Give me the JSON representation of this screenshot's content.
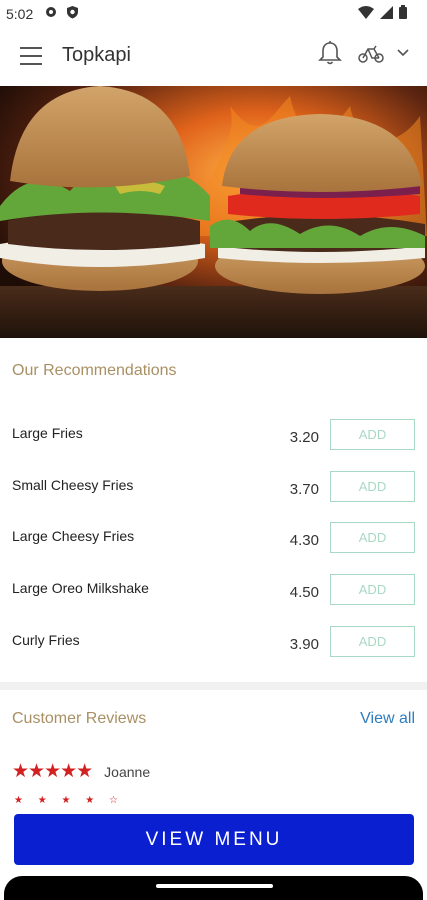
{
  "status": {
    "time": "5:02"
  },
  "app": {
    "title": "Topkapi"
  },
  "recommendations": {
    "title": "Our Recommendations",
    "add_label": "ADD",
    "items": [
      {
        "name": "Large Fries",
        "price": "3.20"
      },
      {
        "name": "Small Cheesy Fries",
        "price": "3.70"
      },
      {
        "name": "Large Cheesy Fries",
        "price": "4.30"
      },
      {
        "name": "Large Oreo Milkshake",
        "price": "4.50"
      },
      {
        "name": "Curly Fries",
        "price": "3.90"
      }
    ]
  },
  "reviews": {
    "title": "Customer Reviews",
    "view_all": "View all",
    "first": {
      "stars": "★★★★★",
      "name": "Joanne"
    },
    "second_stars": "★ ★ ★ ★ ☆"
  },
  "cta": {
    "label": "VIEW MENU"
  },
  "colors": {
    "accent_gold": "#a89064",
    "add_border": "#a9d8c5",
    "link_blue": "#2f7dbf",
    "star_red": "#d32020",
    "cta_blue": "#0a1fd0"
  }
}
